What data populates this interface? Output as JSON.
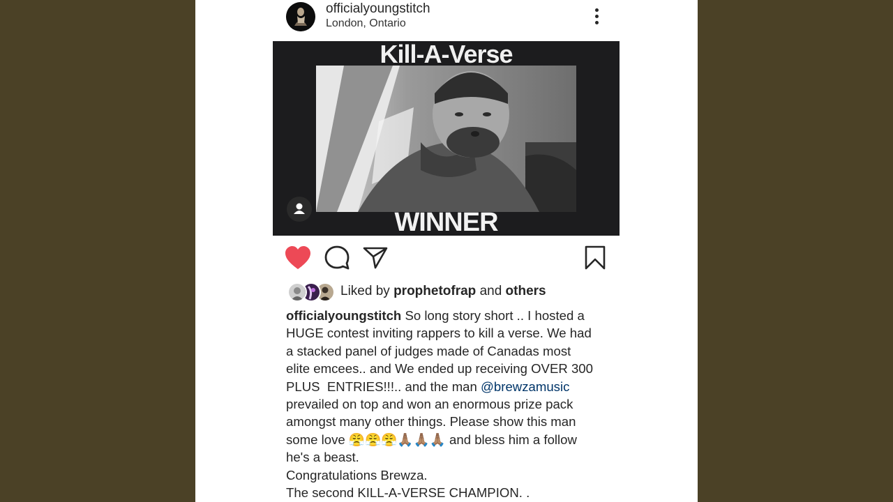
{
  "post": {
    "username": "officialyoungstitch",
    "location": "London, Ontario",
    "media": {
      "title": "Kill-A-Verse",
      "caption": "WINNER",
      "tag_icon": "person-icon"
    },
    "actions": {
      "like_icon": "heart-icon",
      "comment_icon": "comment-icon",
      "share_icon": "paper-plane-icon",
      "save_icon": "bookmark-icon",
      "like_color": "#ed4956"
    },
    "likes": {
      "prefix": "Liked by",
      "user": "prophetofrap",
      "and": "and",
      "others": "others"
    },
    "caption": {
      "user": "officialyoungstitch",
      "line1": "So long story short .. I hosted a",
      "line2": "HUGE contest inviting rappers to kill a verse. We had",
      "line3": "a stacked panel of judges made of Canadas most",
      "line4": "elite emcees.. and We ended up receiving OVER 300",
      "line5_a": "PLUS  ENTRIES!!!.. and the man",
      "mention": "@brewzamusic",
      "line6": "prevailed on top and won an enormous prize pack",
      "line7": "amongst many other things. Please show this man",
      "line8_a": "some love",
      "emojis": "😤😤😤🙏🏽🙏🏽🙏🏽",
      "line8_b": "and bless him a follow",
      "line9": "he's a beast.",
      "line10": "Congratulations Brewza.",
      "line11": "The second KILL-A-VERSE CHAMPION. ."
    },
    "colors": {
      "background": "#4b4126",
      "mention": "#003569"
    }
  }
}
